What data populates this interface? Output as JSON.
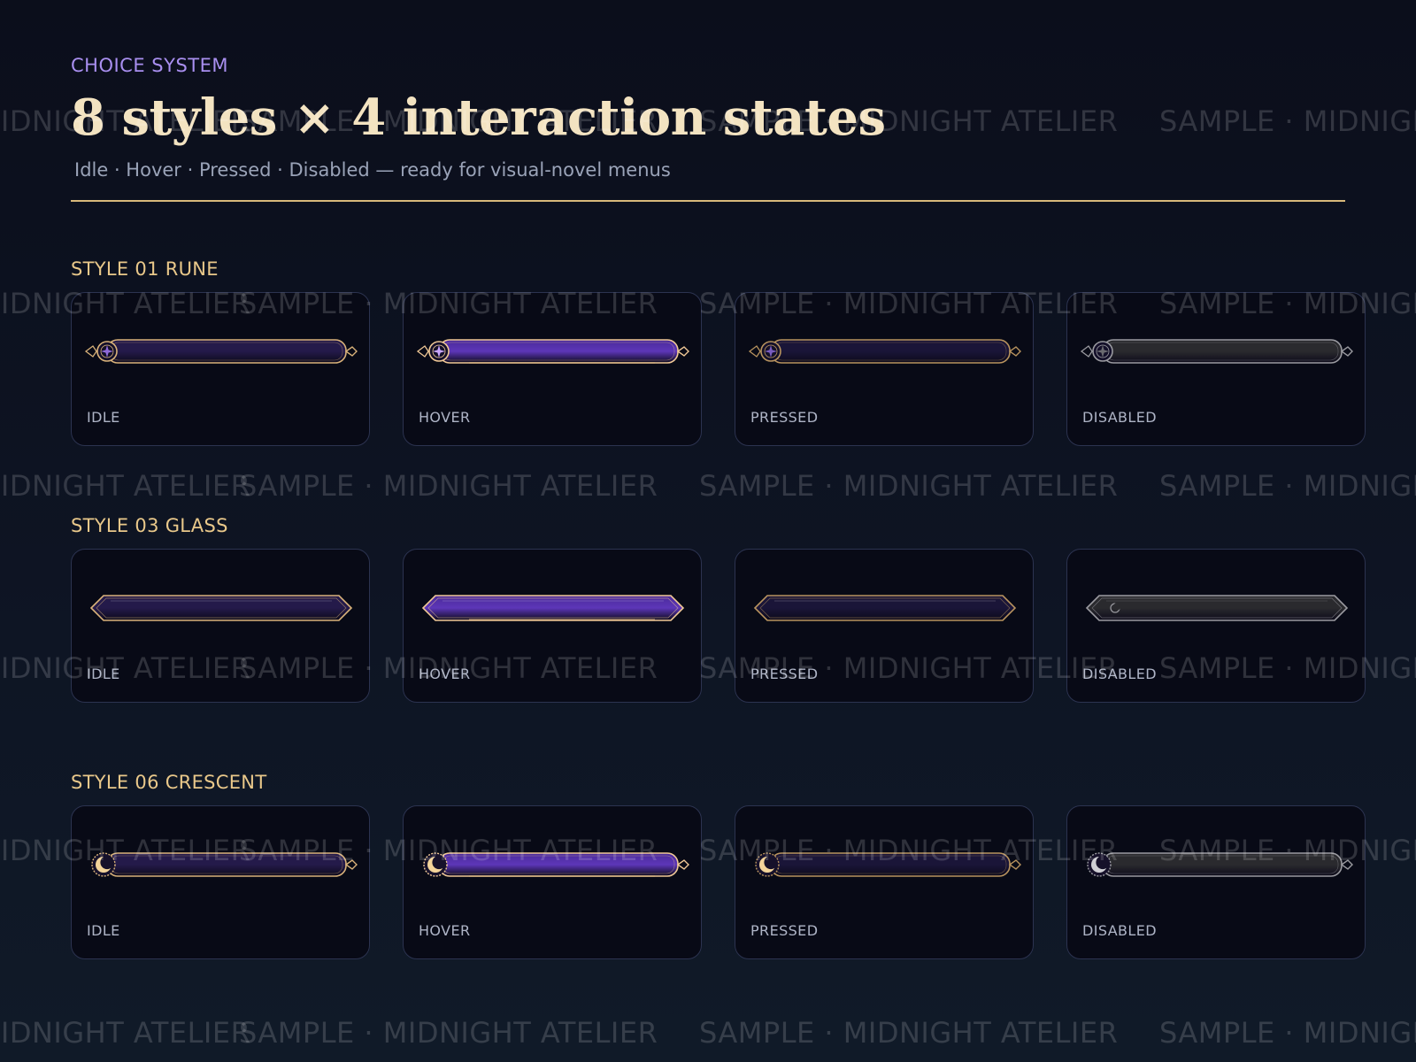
{
  "header": {
    "eyebrow": "CHOICE SYSTEM",
    "title": "8 styles × 4 interaction states",
    "subtitle": "Idle · Hover · Pressed · Disabled — ready for visual-novel menus"
  },
  "watermark": "SAMPLE · MIDNIGHT ATELIER",
  "sections": [
    {
      "label": "STYLE 01  RUNE",
      "ornament": "rune-sigil",
      "states": [
        "IDLE",
        "HOVER",
        "PRESSED",
        "DISABLED"
      ]
    },
    {
      "label": "STYLE 03  GLASS",
      "ornament": "glass-diamond",
      "states": [
        "IDLE",
        "HOVER",
        "PRESSED",
        "DISABLED"
      ]
    },
    {
      "label": "STYLE 06  CRESCENT",
      "ornament": "crescent-moon",
      "states": [
        "IDLE",
        "HOVER",
        "PRESSED",
        "DISABLED"
      ]
    }
  ],
  "colors": {
    "gold": "#d9b27a",
    "violet": "#a98ff0",
    "idle_fill": "#241a4a",
    "hover_fill": "#4a2a9a",
    "pressed_fill": "#1a1538",
    "disabled_fill": "#2a2a2e",
    "disabled_frame": "#9a9aa0"
  }
}
